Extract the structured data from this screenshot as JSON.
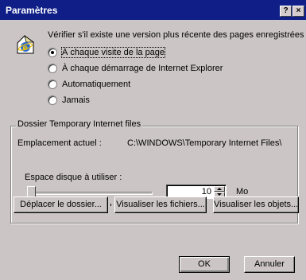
{
  "window": {
    "title": "Paramètres",
    "help_button": "?",
    "close_button": "×"
  },
  "check_prompt": "Vérifier s'il existe une version plus récente des pages enregistrées :",
  "radio_options": [
    {
      "label": "À chaque visite de la page",
      "checked": true
    },
    {
      "label": "À chaque démarrage de Internet Explorer",
      "checked": false
    },
    {
      "label": "Automatiquement",
      "checked": false
    },
    {
      "label": "Jamais",
      "checked": false
    }
  ],
  "temp_files_group": {
    "title": "Dossier Temporary Internet files",
    "location_label": "Emplacement actuel :",
    "location_value": "C:\\WINDOWS\\Temporary Internet Files\\",
    "space_label": "Espace disque à utiliser :",
    "disk_space_value": "10",
    "disk_space_unit": "Mo",
    "slider_level": 0.0
  },
  "buttons": {
    "move_folder": "Déplacer le dossier...",
    "view_files": "Visualiser les fichiers...",
    "view_objects": "Visualiser les objets...",
    "ok": "OK",
    "cancel": "Annuler"
  },
  "colors": {
    "titlebar": "#0f1f87",
    "dialog_bg": "#ccc5c5"
  },
  "icons": {
    "page_icon": "internet-explorer-page-icon"
  }
}
